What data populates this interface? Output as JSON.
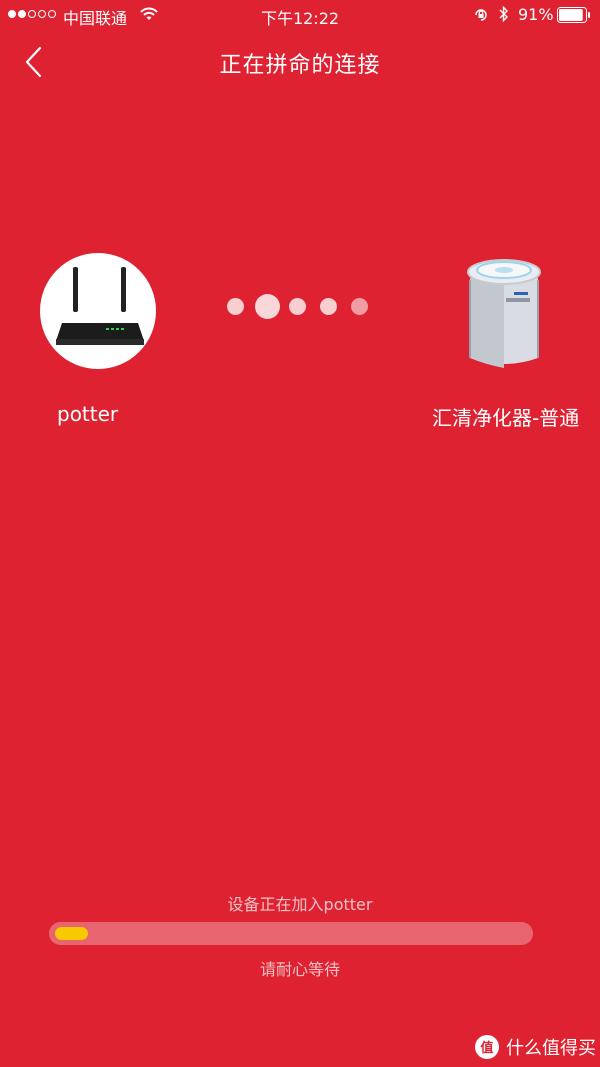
{
  "status_bar": {
    "carrier": "中国联通",
    "time": "下午12:22",
    "battery_percent": "91%",
    "battery_level": 0.91,
    "signal_bars_filled": 2,
    "signal_bars_total": 5
  },
  "nav": {
    "title": "正在拼命的连接"
  },
  "devices": {
    "router_name": "potter",
    "purifier_name": "汇清净化器-普通"
  },
  "status": {
    "joining_text": "设备正在加入potter",
    "progress_fraction": 0.07,
    "wait_text": "请耐心等待"
  },
  "watermark": {
    "text": "什么值得买"
  },
  "colors": {
    "background": "#df2231",
    "progress_fill": "#f9c900"
  },
  "icons": [
    "wifi-icon",
    "rotation-lock-icon",
    "bluetooth-icon",
    "battery-icon",
    "back-chevron-icon",
    "router-icon",
    "air-purifier-icon",
    "smzdm-logo-icon"
  ]
}
